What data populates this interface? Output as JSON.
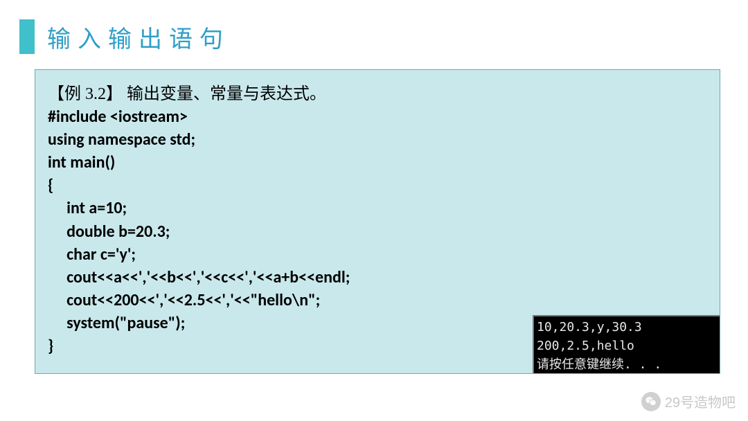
{
  "slide": {
    "title": "输入输出语句"
  },
  "example": {
    "label": "【例 3.2】",
    "description": "  输出变量、常量与表达式。"
  },
  "code": {
    "l1": "#include <iostream>",
    "l2": "using namespace std;",
    "l3": "int main()",
    "l4": "{",
    "l5": "     int a=10;",
    "l6": "     double b=20.3;",
    "l7": "     char c='y';",
    "l8": "     cout<<a<<','<<b<<','<<c<<','<<a+b<<endl;",
    "l9": "     cout<<200<<','<<2.5<<','<<\"hello\\n\";",
    "l10": "     system(\"pause\");",
    "l11": "}"
  },
  "console": {
    "line1": "10,20.3,y,30.3",
    "line2": "200,2.5,hello",
    "line3": "请按任意键继续. . ."
  },
  "watermark": {
    "text": "29号造物吧"
  }
}
